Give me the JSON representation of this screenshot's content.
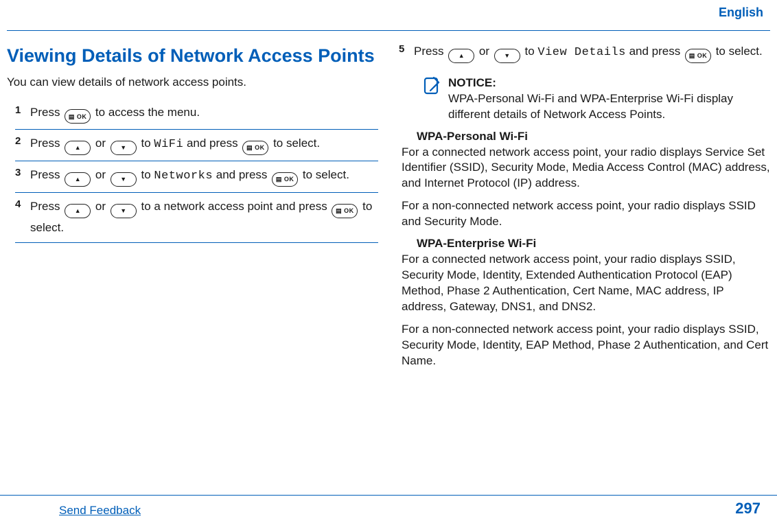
{
  "lang_label": "English",
  "section_title": "Viewing Details of Network Access Points",
  "intro": "You can view details of network access points.",
  "steps": {
    "s1": {
      "n": "1",
      "a": "Press ",
      "b": " to access the menu."
    },
    "s2": {
      "n": "2",
      "a": "Press ",
      "b": " or ",
      "c": " to ",
      "code": "WiFi",
      "d": " and press ",
      "e": " to select."
    },
    "s3": {
      "n": "3",
      "a": "Press ",
      "b": " or ",
      "c": " to ",
      "code": "Networks",
      "d": " and press ",
      "e": " to select."
    },
    "s4": {
      "n": "4",
      "a": "Press ",
      "b": " or ",
      "c": " to a network access point and press ",
      "d": " to select."
    },
    "s5": {
      "n": "5",
      "a": "Press ",
      "b": " or ",
      "c": " to ",
      "code": "View Details",
      "d": " and press ",
      "e": " to select."
    }
  },
  "notice": {
    "label": "NOTICE:",
    "text": "WPA-Personal Wi-Fi and WPA-Enterprise Wi-Fi display different details of Network Access Points."
  },
  "wpa_personal": {
    "term": "WPA-Personal Wi-Fi",
    "p1": "For a connected network access point, your radio displays Service Set Identifier (SSID), Security Mode, Media Access Control (MAC) address, and Internet Protocol (IP) address.",
    "p2": "For a non-connected network access point, your radio displays SSID and Security Mode."
  },
  "wpa_enterprise": {
    "term": "WPA-Enterprise Wi-Fi",
    "p1": "For a connected network access point, your radio displays SSID, Security Mode, Identity, Extended Authentication Protocol (EAP) Method, Phase 2 Authentication, Cert Name, MAC address, IP address, Gateway, DNS1, and DNS2.",
    "p2": "For a non-connected network access point, your radio displays SSID, Security Mode, Identity, EAP Method, Phase 2 Authentication, and Cert Name."
  },
  "footer": {
    "feedback": "Send Feedback",
    "page": "297"
  }
}
